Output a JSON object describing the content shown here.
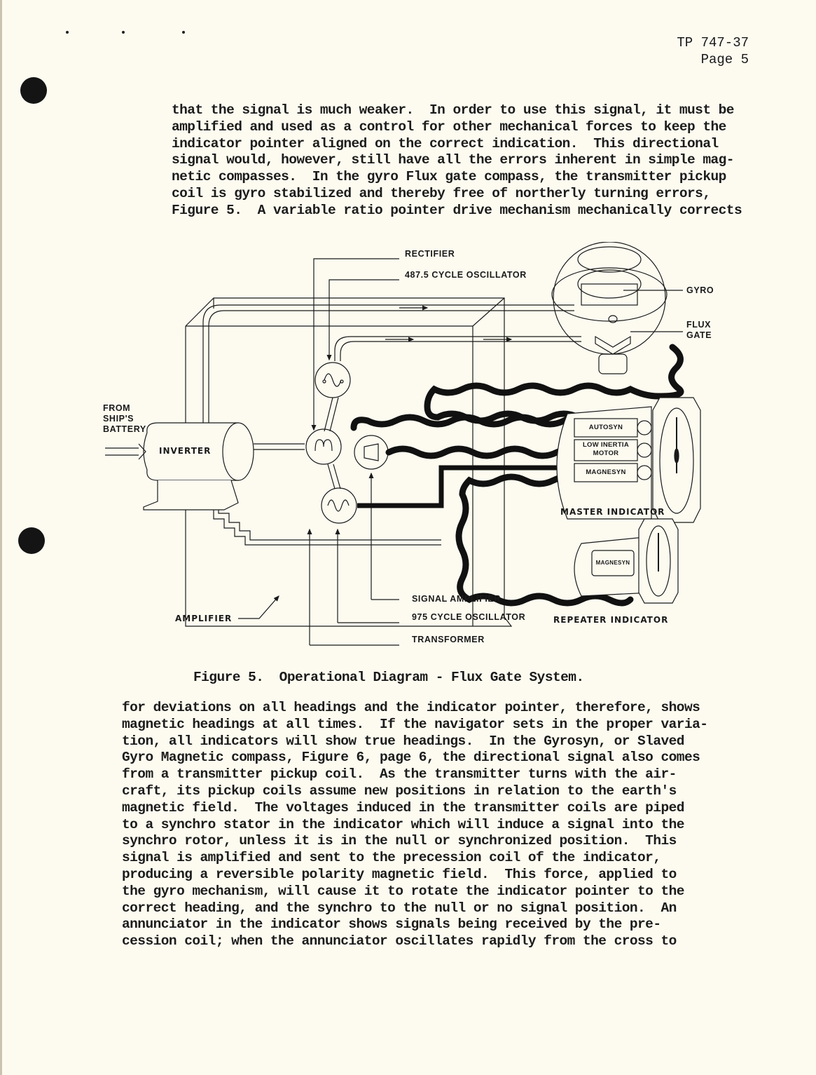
{
  "document": {
    "header": {
      "doc_number": "TP 747-37",
      "page_label": "Page 5"
    },
    "paragraph_top": [
      "that the signal is much weaker.  In order to use this signal, it must be",
      "amplified and used as a control for other mechanical forces to keep the",
      "indicator pointer aligned on the correct indication.  This directional",
      "signal would, however, still have all the errors inherent in simple mag-",
      "netic compasses.  In the gyro Flux gate compass, the transmitter pickup",
      "coil is gyro stabilized and thereby free of northerly turning errors,",
      "Figure 5.  A variable ratio pointer drive mechanism mechanically corrects"
    ],
    "figure": {
      "caption": "Figure 5.  Operational Diagram - Flux Gate System.",
      "labels": {
        "rectifier": "RECTIFIER",
        "oscillator_487": "487.5 CYCLE OSCILLATOR",
        "gyro": "GYRO",
        "flux_gate": "FLUX\nGATE",
        "from_battery": "FROM\nSHIP'S\nBATTERY",
        "inverter": "INVERTER",
        "autosyn": "AUTOSYN",
        "low_inertia_motor": "LOW INERTIA\nMOTOR",
        "magnesyn_master": "MAGNESYN",
        "master_indicator": "MASTER INDICATOR",
        "magnesyn_repeater": "MAGNESYN",
        "signal_amplifier": "SIGNAL AMPLIFIER",
        "oscillator_975": "975 CYCLE OSCILLATOR",
        "transformer": "TRANSFORMER",
        "amplifier": "AMPLIFIER",
        "repeater_indicator": "REPEATER INDICATOR"
      }
    },
    "paragraph_bottom": [
      "for deviations on all headings and the indicator pointer, therefore, shows",
      "magnetic headings at all times.  If the navigator sets in the proper varia-",
      "tion, all indicators will show true headings.  In the Gyrosyn, or Slaved",
      "Gyro Magnetic compass, Figure 6, page 6, the directional signal also comes",
      "from a transmitter pickup coil.  As the transmitter turns with the air-",
      "craft, its pickup coils assume new positions in relation to the earth's",
      "magnetic field.  The voltages induced in the transmitter coils are piped",
      "to a synchro stator in the indicator which will induce a signal into the",
      "synchro rotor, unless it is in the null or synchronized position.  This",
      "signal is amplified and sent to the precession coil of the indicator,",
      "producing a reversible polarity magnetic field.  This force, applied to",
      "the gyro mechanism, will cause it to rotate the indicator pointer to the",
      "correct heading, and the synchro to the null or no signal position.  An",
      "annunciator in the indicator shows signals being received by the pre-",
      "cession coil; when the annunciator oscillates rapidly from the cross to"
    ]
  }
}
